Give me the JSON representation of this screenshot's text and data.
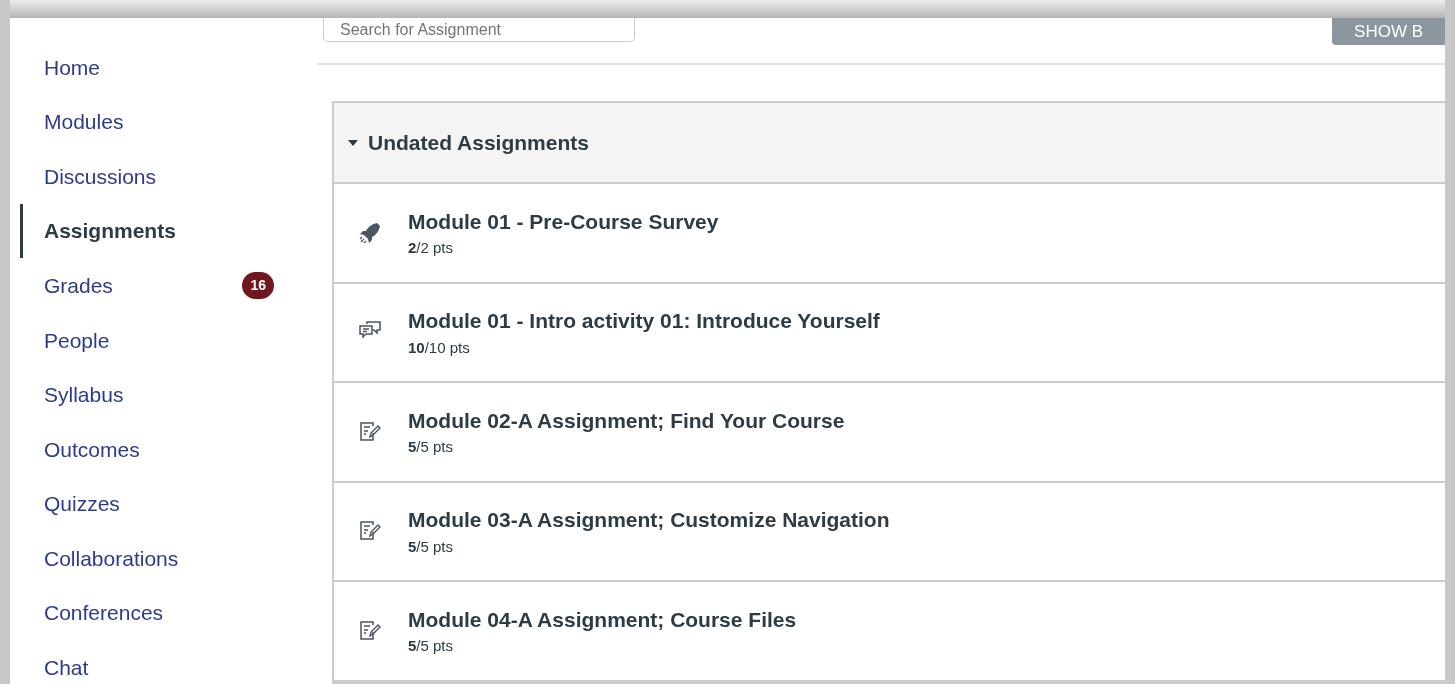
{
  "sidebar": {
    "items": [
      {
        "label": "Home",
        "selected": false
      },
      {
        "label": "Modules",
        "selected": false
      },
      {
        "label": "Discussions",
        "selected": false
      },
      {
        "label": "Assignments",
        "selected": true
      },
      {
        "label": "Grades",
        "selected": false,
        "badge": "16"
      },
      {
        "label": "People",
        "selected": false
      },
      {
        "label": "Syllabus",
        "selected": false
      },
      {
        "label": "Outcomes",
        "selected": false
      },
      {
        "label": "Quizzes",
        "selected": false
      },
      {
        "label": "Collaborations",
        "selected": false
      },
      {
        "label": "Conferences",
        "selected": false
      },
      {
        "label": "Chat",
        "selected": false
      }
    ]
  },
  "search": {
    "placeholder": "Search for Assignment"
  },
  "show_by_button": "SHOW B",
  "group": {
    "title": "Undated Assignments",
    "expanded": true,
    "assignments": [
      {
        "kind": "quiz",
        "title": "Module 01 - Pre-Course Survey",
        "score": "**2**/2 pts"
      },
      {
        "kind": "discussion",
        "title": "Module 01 - Intro activity 01: Introduce Yourself",
        "score": "**10**/10 pts"
      },
      {
        "kind": "assignment",
        "title": "Module 02-A Assignment; Find Your Course",
        "score": "**5**/5 pts"
      },
      {
        "kind": "assignment",
        "title": "Module 03-A Assignment; Customize Navigation",
        "score": "**5**/5 pts"
      },
      {
        "kind": "assignment",
        "title": "Module 04-A Assignment; Course Files",
        "score": "**5**/5 pts"
      }
    ]
  }
}
